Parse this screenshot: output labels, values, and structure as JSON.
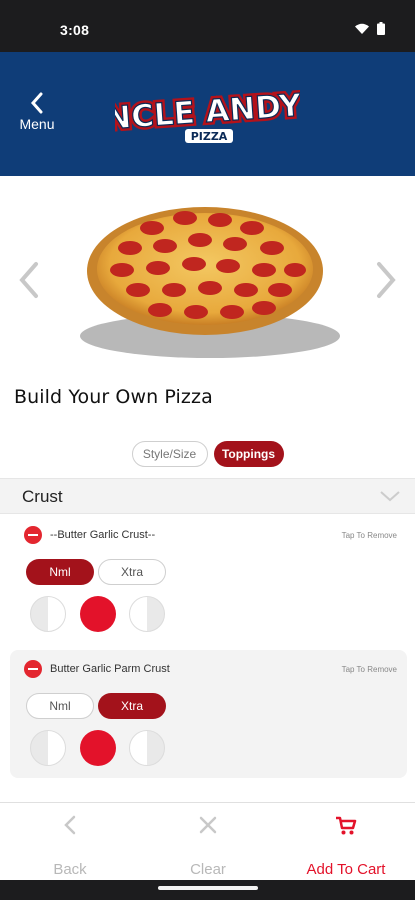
{
  "status": {
    "time": "3:08",
    "wifi_icon": "wifi-icon",
    "battery_icon": "battery-icon"
  },
  "header": {
    "menu_label": "Menu",
    "logo_text": "UNCLE ANDY'S",
    "logo_sub": "PIZZA",
    "bg_color": "#0f3d78"
  },
  "product": {
    "title": "Build Your Own Pizza"
  },
  "tabs": [
    {
      "label": "Style/Size",
      "active": false
    },
    {
      "label": "Toppings",
      "active": true
    }
  ],
  "section": {
    "title": "Crust"
  },
  "options": [
    {
      "name": "--Butter Garlic Crust--",
      "hint": "Tap To Remove",
      "amount_a": "Nml",
      "amount_b": "Xtra",
      "selected_amount": "Nml",
      "portion": "whole"
    },
    {
      "name": "Butter Garlic Parm Crust",
      "hint": "Tap To Remove",
      "amount_a": "Nml",
      "amount_b": "Xtra",
      "selected_amount": "Xtra",
      "portion": "whole"
    }
  ],
  "bottom_bar": {
    "back": "Back",
    "clear": "Clear",
    "add_to_cart": "Add To Cart"
  },
  "colors": {
    "accent": "#a3121b",
    "red": "#e3122a"
  }
}
